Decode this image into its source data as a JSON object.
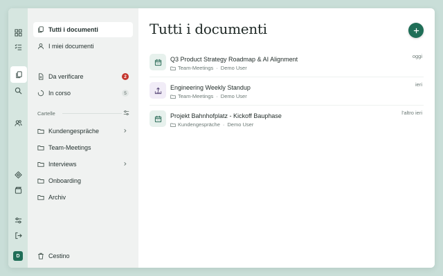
{
  "colors": {
    "accent": "#1f6e57",
    "badge_red": "#c4362e",
    "background": "#c9ded8"
  },
  "rail": {
    "icons": [
      "dashboard-icon",
      "checklist-icon",
      "documents-icon",
      "search-icon",
      "users-icon",
      "puzzle-icon",
      "clapperboard-icon",
      "sliders-icon",
      "logout-icon"
    ],
    "avatar_initial": "D"
  },
  "sidebar": {
    "all_docs": "Tutti i documenti",
    "my_docs": "I miei documenti",
    "to_verify": "Da verificare",
    "to_verify_count": "2",
    "in_progress": "In corso",
    "in_progress_count": "5",
    "folders_label": "Cartelle",
    "folders": [
      {
        "label": "Kundengespräche",
        "expandable": true
      },
      {
        "label": "Team-Meetings",
        "expandable": false
      },
      {
        "label": "Interviews",
        "expandable": true
      },
      {
        "label": "Onboarding",
        "expandable": false
      },
      {
        "label": "Archiv",
        "expandable": false
      }
    ],
    "trash": "Cestino"
  },
  "main": {
    "title": "Tutti i documenti",
    "documents": [
      {
        "title": "Q3 Product Strategy Roadmap & AI Alignment",
        "folder": "Team-Meetings",
        "user": "Demo User",
        "date": "oggi",
        "icon": "calendar-icon"
      },
      {
        "title": "Engineering Weekly Standup",
        "folder": "Team-Meetings",
        "user": "Demo User",
        "date": "ieri",
        "icon": "upload-tray-icon"
      },
      {
        "title": "Projekt Bahnhofplatz - Kickoff Bauphase",
        "folder": "Kundengespräche",
        "user": "Demo User",
        "date": "l'altro ieri",
        "icon": "calendar-icon"
      }
    ]
  }
}
